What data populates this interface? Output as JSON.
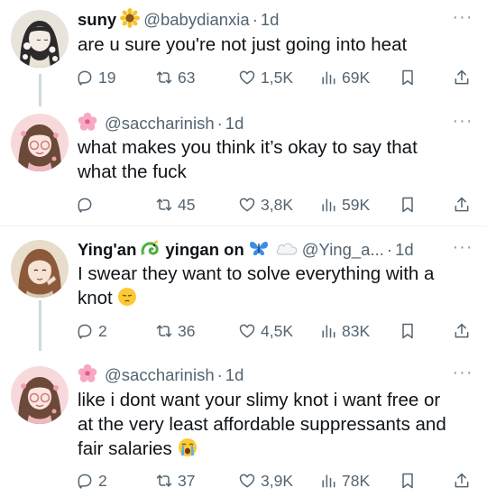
{
  "tweets": [
    {
      "name": "suny",
      "handle": "@babydianxia",
      "sep": "·",
      "time": "1d",
      "text_lines": [
        "are u sure you're not just going into heat"
      ],
      "replies": "19",
      "retweets": "63",
      "likes": "1,5K",
      "views": "69K",
      "avatar_style": "anime-dark-hair-flowers"
    },
    {
      "name": "",
      "handle": "@saccharinish",
      "sep": "·",
      "time": "1d",
      "text_lines": [
        "what makes you think it’s okay to say that",
        "what the fuck"
      ],
      "replies": "",
      "retweets": "45",
      "likes": "3,8K",
      "views": "59K",
      "avatar_style": "pink-anime-girl"
    },
    {
      "name": "Ying'an",
      "name2": "yingan on",
      "handle": "@Ying_a...",
      "sep": "·",
      "time": "1d",
      "text_lines": [
        "I swear they want to solve everything with a",
        "knot"
      ],
      "replies": "2",
      "retweets": "36",
      "likes": "4,5K",
      "views": "83K",
      "avatar_style": "anime-brown-hair"
    },
    {
      "name": "",
      "handle": "@saccharinish",
      "sep": "·",
      "time": "1d",
      "text_lines": [
        "like i dont want your slimy knot i want free or",
        "at the very least affordable suppressants and",
        "fair salaries"
      ],
      "replies": "2",
      "retweets": "37",
      "likes": "3,9K",
      "views": "78K",
      "avatar_style": "pink-anime-girl"
    }
  ],
  "more_label": "···",
  "colors": {
    "text": "#0f1419",
    "muted": "#536471",
    "thread": "#cfd9de",
    "divider": "#eff3f4"
  },
  "icons": [
    "reply-icon",
    "retweet-icon",
    "like-icon",
    "views-icon",
    "bookmark-icon",
    "share-icon"
  ]
}
